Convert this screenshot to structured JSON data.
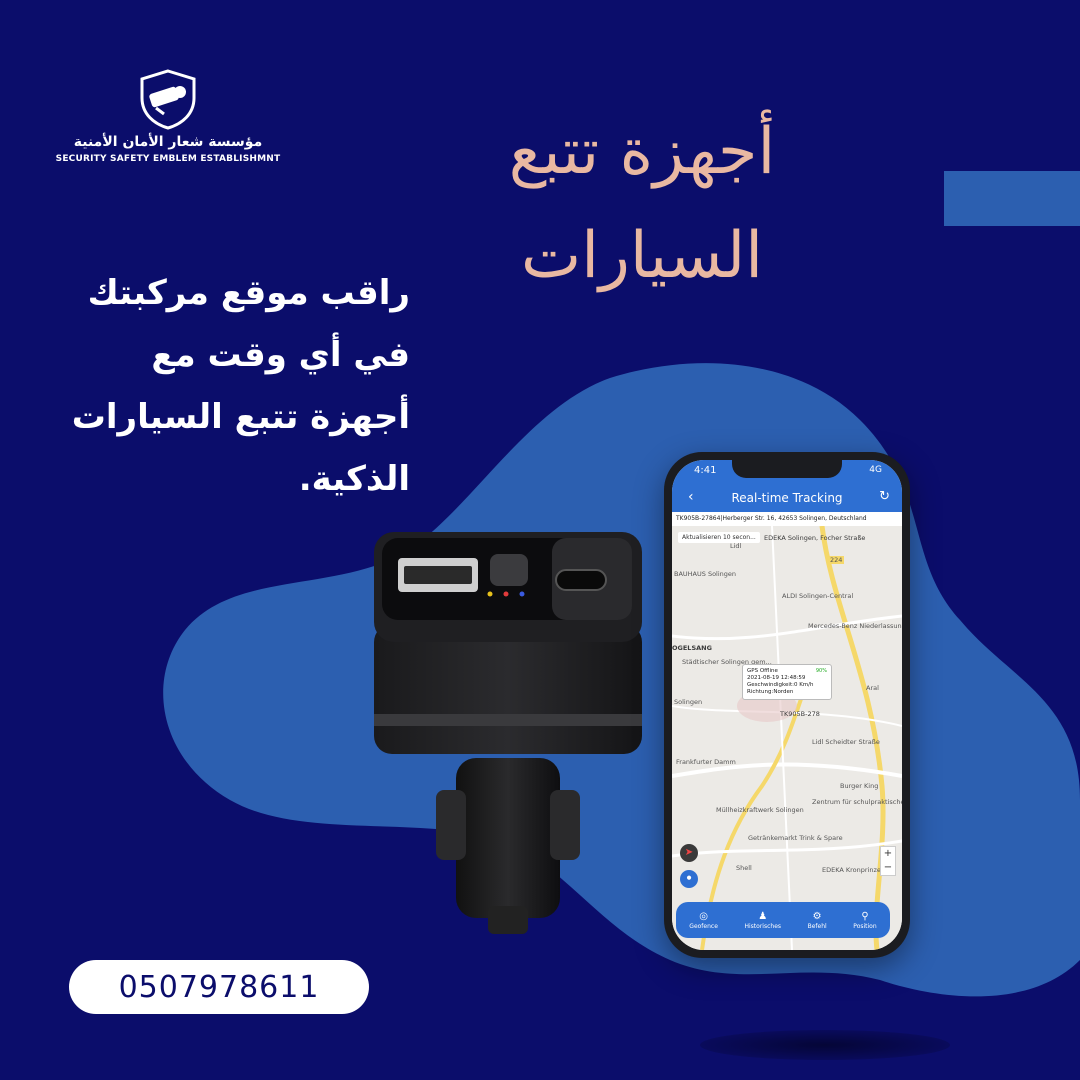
{
  "brand": {
    "name_ar": "مؤسسة شعار الأمان الأمنية",
    "name_en": "SECURITY SAFETY EMBLEM ESTABLISHMNT",
    "logo_icon": "shield-camera-icon"
  },
  "headline": {
    "line1": "أجهزة تتبع",
    "line2": "السيارات"
  },
  "subtext": {
    "line1": "راقب موقع مركبتك",
    "line2": "في أي وقت مع",
    "line3": "أجهزة تتبع السيارات",
    "line4": "الذكية."
  },
  "contact": {
    "phone": "0507978611"
  },
  "colors": {
    "background": "#0b0d6b",
    "blob": "#2c5fb0",
    "headline": "#e9b8a2",
    "accent": "#2e6fd2"
  },
  "device": {
    "icon": "car-charger-gps-tracker"
  },
  "phone_app": {
    "status_time": "4:41",
    "status_signal": "4G",
    "back_icon": "chevron-left-icon",
    "title": "Real-time Tracking",
    "refresh_icon": "refresh-icon",
    "address": "TK905B-27864|Herberger Str. 16, 42653 Solingen, Deutschland",
    "update_chip": "Aktualisieren 10 secon...",
    "map_labels": [
      "EDEKA Solingen, Focher Straße",
      "Lidl",
      "BAUHAUS Solingen",
      "ALDI Solingen-Central",
      "Mercedes-Benz Niederlassung...",
      "OGELSANG",
      "Städtischer Solingen gem...",
      "Aral",
      "Solingen",
      "Lidl Scheidter Straße",
      "Frankfurter Damm",
      "Burger King",
      "Müllheizkraftwerk Solingen",
      "Zentrum für schulpraktische...",
      "Getränkemarkt Trink & Spare",
      "Shell",
      "EDEKA Kronprinzen",
      "224"
    ],
    "gps_popup": {
      "battery": "90%",
      "status": "GPS Offline",
      "datetime": "2021-08-19 12:48:59",
      "speed": "Geschwindigkeit:0 Km/h",
      "direction": "Richtung:Norden"
    },
    "marker_label": "TK905B-278",
    "nav": [
      {
        "label": "Geofence",
        "icon": "geofence-icon"
      },
      {
        "label": "Historisches",
        "icon": "history-icon"
      },
      {
        "label": "Befehl",
        "icon": "gear-icon"
      },
      {
        "label": "Position",
        "icon": "location-pin-icon"
      }
    ]
  }
}
